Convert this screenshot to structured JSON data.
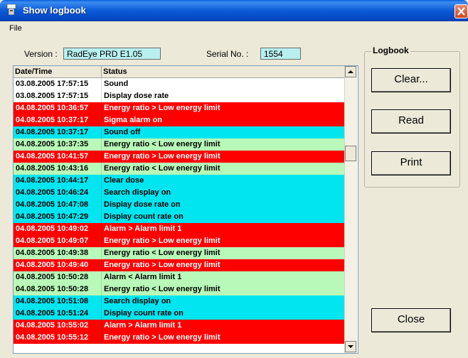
{
  "window": {
    "title": "Show logbook"
  },
  "menu": {
    "file": "File"
  },
  "info": {
    "version_label": "Version :",
    "version_value": "RadEye PRD E1.05",
    "serial_label": "Serial No. :",
    "serial_value": "1554"
  },
  "list": {
    "headers": [
      "Date/Time",
      "Status"
    ],
    "rows": [
      {
        "date": "03.08.2005 17:57:15",
        "status": "Sound",
        "color": "#ffffff",
        "text": "#000000"
      },
      {
        "date": "03.08.2005 17:57:15",
        "status": "Display dose rate",
        "color": "#ffffff",
        "text": "#000000"
      },
      {
        "date": "04.08.2005 10:36:57",
        "status": "Energy ratio > Low energy limit",
        "color": "#ff0000",
        "text": "#ffffff"
      },
      {
        "date": "04.08.2005 10:37:17",
        "status": "Sigma alarm on",
        "color": "#ff0000",
        "text": "#ffffff"
      },
      {
        "date": "04.08.2005 10:37:17",
        "status": "Sound off",
        "color": "#00e5f0",
        "text": "#000000"
      },
      {
        "date": "04.08.2005 10:37:35",
        "status": "Energy ratio < Low energy limit",
        "color": "#b8f8b8",
        "text": "#000000"
      },
      {
        "date": "04.08.2005 10:41:57",
        "status": "Energy ratio > Low energy limit",
        "color": "#ff0000",
        "text": "#ffffff"
      },
      {
        "date": "04.08.2005 10:43:16",
        "status": "Energy ratio < Low energy limit",
        "color": "#b8f8b8",
        "text": "#000000"
      },
      {
        "date": "04.08.2005 10:44:17",
        "status": "Clear dose",
        "color": "#00e5f0",
        "text": "#000000"
      },
      {
        "date": "04.08.2005 10:46:24",
        "status": "Search display on",
        "color": "#00e5f0",
        "text": "#000000"
      },
      {
        "date": "04.08.2005 10:47:08",
        "status": "Display dose rate on",
        "color": "#00e5f0",
        "text": "#000000"
      },
      {
        "date": "04.08.2005 10:47:29",
        "status": "Display count rate on",
        "color": "#00e5f0",
        "text": "#000000"
      },
      {
        "date": "04.08.2005 10:49:02",
        "status": "Alarm > Alarm limit 1",
        "color": "#ff0000",
        "text": "#ffffff"
      },
      {
        "date": "04.08.2005 10:49:07",
        "status": "Energy ratio > Low energy limit",
        "color": "#ff0000",
        "text": "#ffffff"
      },
      {
        "date": "04.08.2005 10:49:38",
        "status": "Energy ratio < Low energy limit",
        "color": "#b8f8b8",
        "text": "#000000"
      },
      {
        "date": "04.08.2005 10:49:40",
        "status": "Energy ratio > Low energy limit",
        "color": "#ff0000",
        "text": "#ffffff"
      },
      {
        "date": "04.08.2005 10:50:28",
        "status": "Alarm < Alarm limit 1",
        "color": "#b8f8b8",
        "text": "#000000"
      },
      {
        "date": "04.08.2005 10:50:28",
        "status": "Energy ratio < Low energy limit",
        "color": "#b8f8b8",
        "text": "#000000"
      },
      {
        "date": "04.08.2005 10:51:08",
        "status": "Search display on",
        "color": "#00e5f0",
        "text": "#000000"
      },
      {
        "date": "04.08.2005 10:51:24",
        "status": "Display count rate on",
        "color": "#00e5f0",
        "text": "#000000"
      },
      {
        "date": "04.08.2005 10:55:02",
        "status": "Alarm > Alarm limit 1",
        "color": "#ff0000",
        "text": "#ffffff"
      },
      {
        "date": "04.08.2005 10:55:12",
        "status": "Energy ratio > Low energy limit",
        "color": "#ff0000",
        "text": "#ffffff"
      }
    ]
  },
  "logbook": {
    "label": "Logbook",
    "clear": "Clear...",
    "read": "Read",
    "print": "Print"
  },
  "close": "Close",
  "icons": {
    "window_icon": "app-window-icon",
    "close": "close-x-icon",
    "scroll_up": "scroll-up-arrow-icon",
    "scroll_down": "scroll-down-arrow-icon"
  }
}
